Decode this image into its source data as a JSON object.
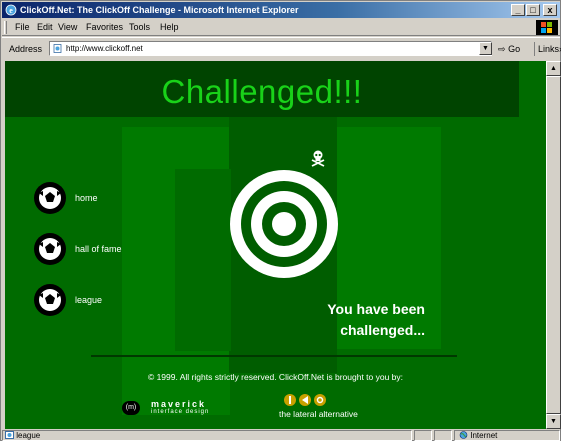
{
  "window": {
    "title": "ClickOff.Net: The ClickOff Challenge - Microsoft Internet Explorer",
    "controls": [
      "_",
      "□",
      "x"
    ]
  },
  "menu": {
    "items": [
      "File",
      "Edit",
      "View",
      "Favorites",
      "Tools",
      "Help"
    ]
  },
  "address_bar": {
    "label": "Address",
    "url": "http://www.clickoff.net",
    "go_label": "Go",
    "links_label": "Links"
  },
  "page": {
    "banner_title": "Challenged!!!",
    "nav": [
      {
        "label": "home"
      },
      {
        "label": "hall of fame"
      },
      {
        "label": "league"
      }
    ],
    "challenge_line1": "You have been",
    "challenge_line2": "challenged...",
    "copyright": "© 1999. All rights strictly reserved. ClickOff.Net is brought to you by:",
    "maverick": {
      "name": "maverick",
      "sub": "interface design"
    },
    "lateral_tagline": "the lateral alternative"
  },
  "status": {
    "text": "league",
    "zone": "Internet"
  },
  "colors": {
    "page_green": "#006b00",
    "banner_dark": "#004400",
    "title_green": "#19d219",
    "block_green": "#007a00"
  }
}
